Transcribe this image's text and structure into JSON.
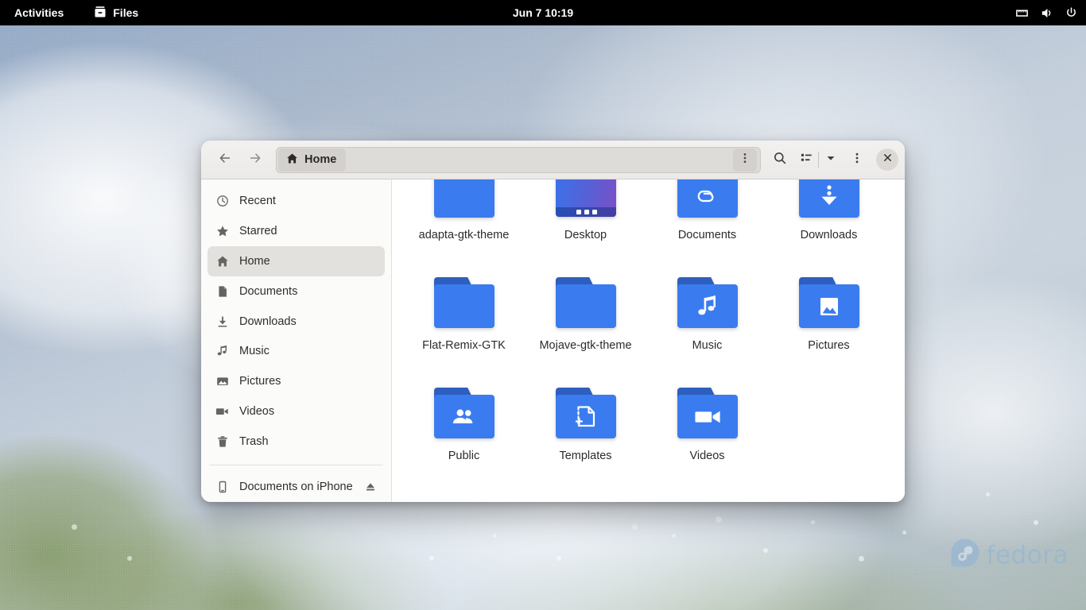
{
  "topbar": {
    "activities_label": "Activities",
    "app_name": "Files",
    "app_icon": "files-icon",
    "clock": "Jun 7  10:19",
    "status_icons": [
      "network-wired-icon",
      "volume-icon",
      "power-icon"
    ]
  },
  "window": {
    "title": "Home",
    "headerbar": {
      "back_icon": "arrow-left-icon",
      "forward_icon": "arrow-right-icon",
      "pathbar": {
        "icon": "home-icon",
        "label": "Home",
        "menu_icon": "vertical-dots-icon"
      },
      "search_icon": "search-icon",
      "view_toggle_icon": "list-view-icon",
      "view_dropdown_icon": "chevron-down-icon",
      "menu_icon": "vertical-dots-icon",
      "close_icon": "close-icon"
    },
    "sidebar": {
      "items": [
        {
          "label": "Recent",
          "icon": "clock-icon",
          "selected": false
        },
        {
          "label": "Starred",
          "icon": "star-icon",
          "selected": false
        },
        {
          "label": "Home",
          "icon": "home-icon",
          "selected": true
        },
        {
          "label": "Documents",
          "icon": "document-icon",
          "selected": false
        },
        {
          "label": "Downloads",
          "icon": "download-icon",
          "selected": false
        },
        {
          "label": "Music",
          "icon": "music-note-icon",
          "selected": false
        },
        {
          "label": "Pictures",
          "icon": "image-icon",
          "selected": false
        },
        {
          "label": "Videos",
          "icon": "video-icon",
          "selected": false
        },
        {
          "label": "Trash",
          "icon": "trash-icon",
          "selected": false
        }
      ],
      "devices": [
        {
          "label": "Documents on iPhone",
          "icon": "phone-icon",
          "eject_icon": "eject-icon"
        }
      ]
    },
    "files": [
      {
        "name": "adapta-gtk-theme",
        "kind": "folder",
        "emblem": "none"
      },
      {
        "name": "Desktop",
        "kind": "screen",
        "emblem": "desktop"
      },
      {
        "name": "Documents",
        "kind": "folder",
        "emblem": "paperclip"
      },
      {
        "name": "Downloads",
        "kind": "folder",
        "emblem": "download"
      },
      {
        "name": "Flat-Remix-GTK",
        "kind": "folder",
        "emblem": "none"
      },
      {
        "name": "Mojave-gtk-theme",
        "kind": "folder",
        "emblem": "none"
      },
      {
        "name": "Music",
        "kind": "folder",
        "emblem": "music"
      },
      {
        "name": "Pictures",
        "kind": "folder",
        "emblem": "image"
      },
      {
        "name": "Public",
        "kind": "folder",
        "emblem": "people"
      },
      {
        "name": "Templates",
        "kind": "folder",
        "emblem": "template"
      },
      {
        "name": "Videos",
        "kind": "folder",
        "emblem": "video"
      }
    ]
  },
  "desktop": {
    "watermark_text": "fedora",
    "watermark_icon": "fedora-logo-icon"
  },
  "colors": {
    "topbar_bg": "#000000",
    "folder_blue": "#3a7cf0",
    "folder_tab_blue": "#2e5fbe",
    "selection_gray": "#e3e1de",
    "watermark_blue": "#8cb3d6"
  }
}
